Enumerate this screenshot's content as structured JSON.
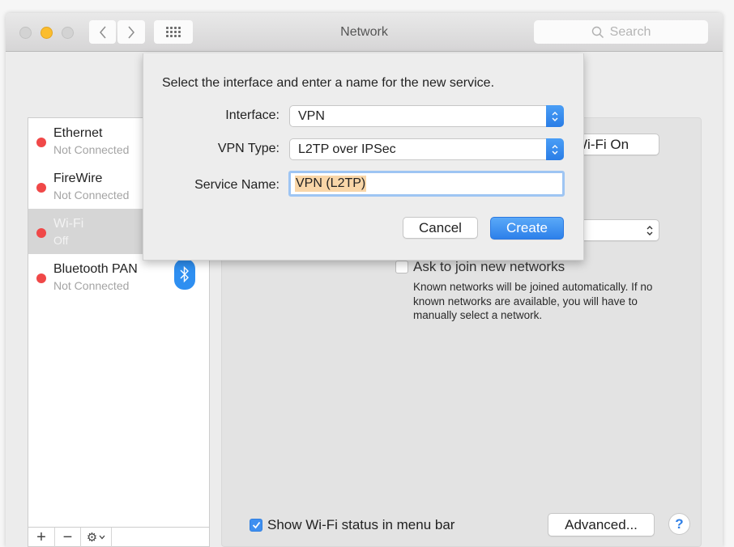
{
  "window": {
    "title": "Network",
    "search_placeholder": "Search",
    "nav": {
      "back_icon": "chevron-left-icon",
      "forward_icon": "chevron-right-icon",
      "grid_icon": "show-all-grid-icon"
    }
  },
  "sidebar": {
    "services": [
      {
        "name": "Ethernet",
        "status": "Not Connected",
        "status_color": "#f04848",
        "selected": false
      },
      {
        "name": "FireWire",
        "status": "Not Connected",
        "status_color": "#f04848",
        "selected": false
      },
      {
        "name": "Wi-Fi",
        "status": "Off",
        "status_color": "#f04848",
        "selected": true
      },
      {
        "name": "Bluetooth PAN",
        "status": "Not Connected",
        "status_color": "#f04848",
        "selected": false,
        "icon": "bluetooth-icon"
      }
    ],
    "footer": {
      "add_label": "+",
      "remove_label": "−",
      "action_label": "⚙"
    }
  },
  "panel": {
    "wifi_button_label": "Wi-Fi On",
    "ask_to_join_label": "Ask to join new networks",
    "ask_to_join_checked": false,
    "ask_to_join_note": "Known networks will be joined automatically. If no known networks are available, you will have to manually select a network.",
    "show_status_label": "Show Wi-Fi status in menu bar",
    "show_status_checked": true,
    "advanced_label": "Advanced...",
    "help_label": "?"
  },
  "sheet": {
    "prompt": "Select the interface and enter a name for the new service.",
    "interface_label": "Interface:",
    "interface_value": "VPN",
    "vpn_type_label": "VPN Type:",
    "vpn_type_value": "L2TP over IPSec",
    "service_name_label": "Service Name:",
    "service_name_value": "VPN (L2TP)",
    "cancel_label": "Cancel",
    "create_label": "Create"
  },
  "colors": {
    "accent": "#2d80ea",
    "status_red": "#f04848",
    "selection_highlight": "#f9d6a8",
    "minimize_yellow": "#fbbd2e"
  }
}
